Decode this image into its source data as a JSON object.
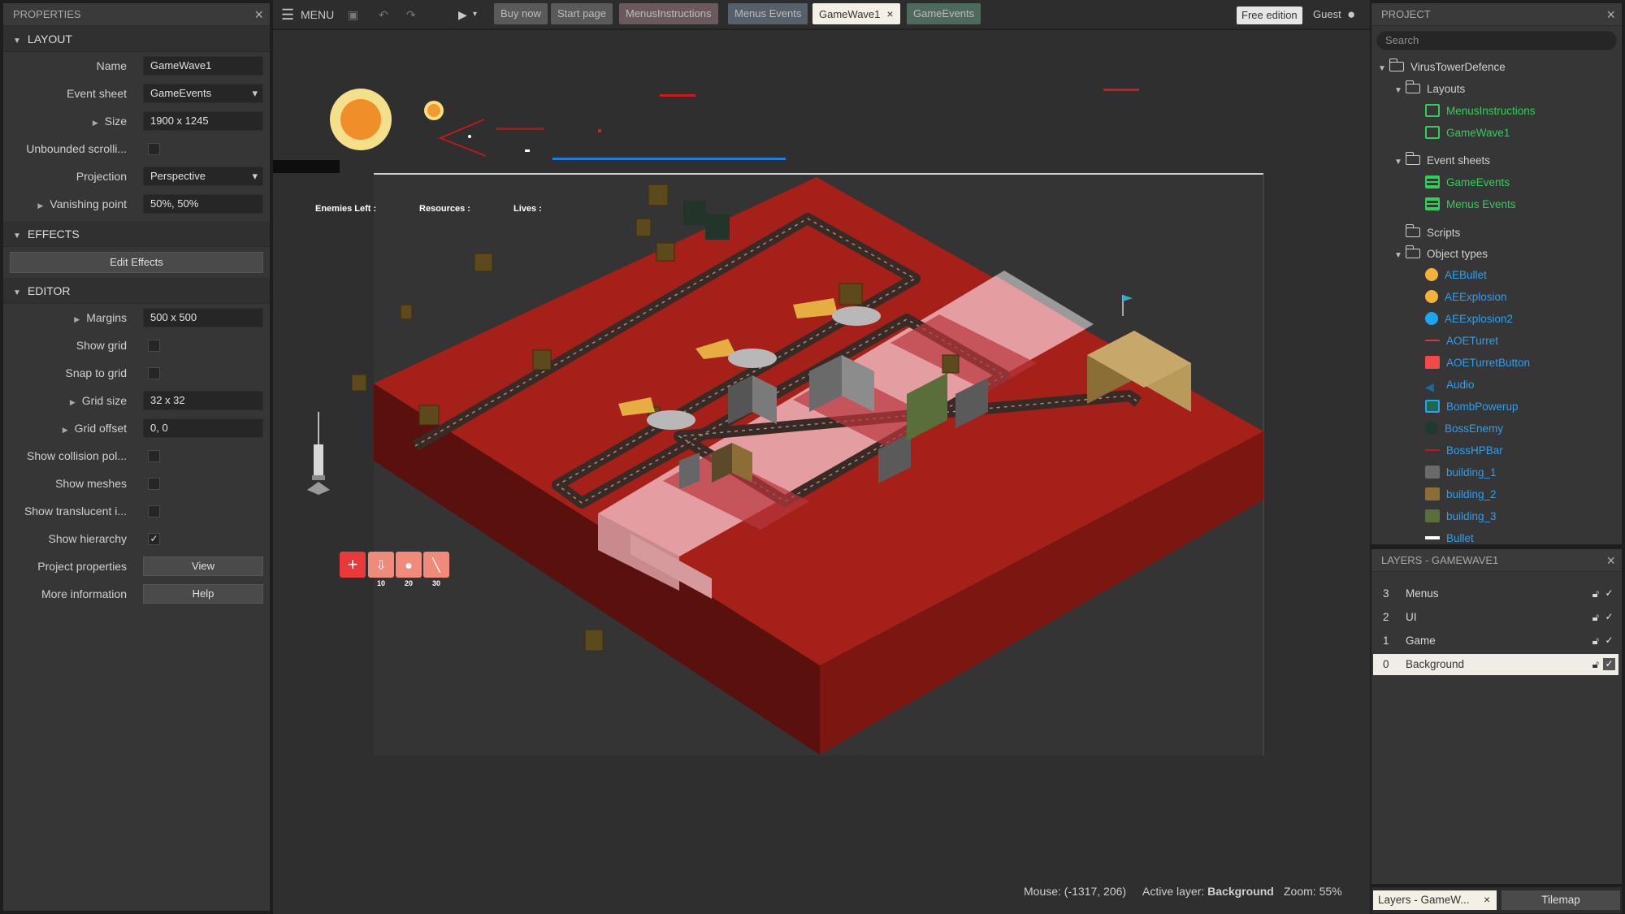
{
  "properties": {
    "title": "PROPERTIES",
    "sections": {
      "layout": "LAYOUT",
      "effects": "EFFECTS",
      "editor": "EDITOR"
    },
    "layout_rows": {
      "name_label": "Name",
      "name_value": "GameWave1",
      "eventsheet_label": "Event sheet",
      "eventsheet_value": "GameEvents",
      "size_label": "Size",
      "size_value": "1900 x 1245",
      "unbounded_label": "Unbounded scrolli...",
      "projection_label": "Projection",
      "projection_value": "Perspective",
      "vanishing_label": "Vanishing point",
      "vanishing_value": "50%, 50%"
    },
    "effects_button": "Edit Effects",
    "editor_rows": {
      "margins_label": "Margins",
      "margins_value": "500 x 500",
      "showgrid_label": "Show grid",
      "snap_label": "Snap to grid",
      "gridsize_label": "Grid size",
      "gridsize_value": "32 x 32",
      "gridoffset_label": "Grid offset",
      "gridoffset_value": "0, 0",
      "collision_label": "Show collision pol...",
      "meshes_label": "Show meshes",
      "translucent_label": "Show translucent i...",
      "hierarchy_label": "Show hierarchy",
      "projprops_label": "Project properties",
      "projprops_button": "View",
      "moreinfo_label": "More information",
      "moreinfo_button": "Help"
    },
    "checked_mark": "✓"
  },
  "toolbar": {
    "menu_label": "MENU",
    "tabs": [
      "Buy now",
      "Start page",
      "MenusInstructions",
      "Menus Events",
      "GameWave1",
      "GameEvents"
    ],
    "active_close": "×",
    "free_edition": "Free edition",
    "user": "Guest"
  },
  "canvas": {
    "hud": {
      "enemies": "Enemies Left :",
      "resources": "Resources :",
      "lives": "Lives :"
    },
    "turret_costs": [
      "10",
      "20",
      "30"
    ],
    "status": {
      "mouse": "Mouse: (-1317, 206)",
      "active_layer_label": "Active layer:",
      "active_layer_value": "Background",
      "zoom": "Zoom: 55%"
    }
  },
  "project": {
    "title": "PROJECT",
    "search_placeholder": "Search",
    "root": "VirusTowerDefence",
    "layouts_folder": "Layouts",
    "layouts": [
      "MenusInstructions",
      "GameWave1"
    ],
    "eventsheets_folder": "Event sheets",
    "eventsheets": [
      "GameEvents",
      "Menus Events"
    ],
    "scripts_folder": "Scripts",
    "objecttypes_folder": "Object types",
    "object_types": [
      "AEBullet",
      "AEExplosion",
      "AEExplosion2",
      "AOETurret",
      "AOETurretButton",
      "Audio",
      "BombPowerup",
      "BossEnemy",
      "BossHPBar",
      "building_1",
      "building_2",
      "building_3",
      "Bullet"
    ]
  },
  "layers": {
    "title": "LAYERS - GAMEWAVE1",
    "items": [
      {
        "num": "3",
        "name": "Menus"
      },
      {
        "num": "2",
        "name": "UI"
      },
      {
        "num": "1",
        "name": "Game"
      },
      {
        "num": "0",
        "name": "Background"
      }
    ]
  },
  "bottom_tabs": {
    "layers_tab": "Layers - GameW...",
    "tilemap_tab": "Tilemap"
  },
  "colors": {
    "accent_green": "#2ed158",
    "accent_blue": "#2aa0f0",
    "board_red": "#a42018",
    "road_pink": "#e8a4a8"
  },
  "icons": [
    "menu-icon",
    "save-icon",
    "undo-icon",
    "redo-icon",
    "play-icon",
    "user-icon",
    "close-icon",
    "folder-icon",
    "lock-icon"
  ]
}
